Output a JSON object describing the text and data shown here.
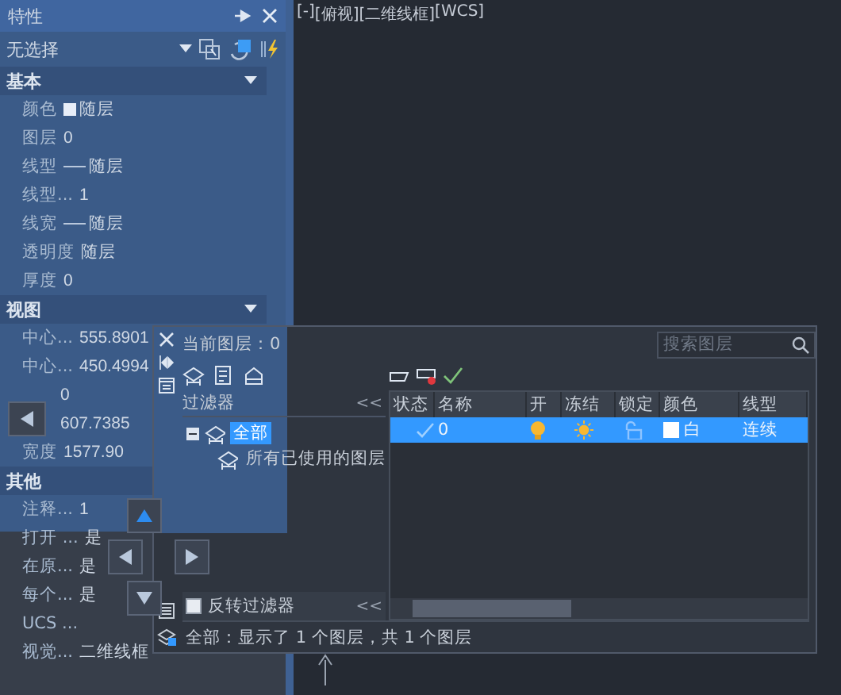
{
  "properties": {
    "title": "特性",
    "selection": "无选择",
    "sections": [
      {
        "title": "基本",
        "expanded": true,
        "rows": [
          {
            "kind": "color",
            "label": "颜色",
            "value": "随层"
          },
          {
            "kind": "text",
            "label": "图层",
            "value": "0"
          },
          {
            "kind": "linetype",
            "label": "线型",
            "value": "随层"
          },
          {
            "kind": "text",
            "label": "线型...",
            "value": "1"
          },
          {
            "kind": "linetype",
            "label": "线宽",
            "value": "随层"
          },
          {
            "kind": "text",
            "label": "透明度",
            "value": "随层"
          },
          {
            "kind": "text",
            "label": "厚度",
            "value": "0"
          }
        ]
      },
      {
        "title": "视图",
        "expanded": true,
        "rows": [
          {
            "kind": "text",
            "label": "中心...",
            "value": "555.8901"
          },
          {
            "kind": "text",
            "label": "中心...",
            "value": "450.4994"
          },
          {
            "kind": "text",
            "value": "0"
          },
          {
            "kind": "text",
            "value": "607.7385"
          },
          {
            "kind": "text",
            "label": "宽度",
            "value": "1577.90"
          }
        ]
      },
      {
        "title": "其他",
        "rows": [
          {
            "kind": "text",
            "label": "注释...",
            "value": "1"
          },
          {
            "kind": "text",
            "label": "打开 ...",
            "value": "是"
          },
          {
            "kind": "text",
            "label": "在原...",
            "value": "是"
          },
          {
            "kind": "text",
            "label": "每个...",
            "value": "是"
          },
          {
            "kind": "text",
            "label": "UCS ..."
          },
          {
            "kind": "text",
            "label": "视觉...",
            "value": "二维线框"
          }
        ]
      }
    ]
  },
  "viewport_controls": [
    "[-]",
    "[俯视]",
    "[二维线框]",
    "[WCS]"
  ],
  "layer_manager": {
    "current_layer": "当前图层：0",
    "search": {
      "placeholder": "搜索图层"
    },
    "filters_title": "过滤器",
    "filters_collapse": "<<",
    "filters": [
      {
        "label": "全部",
        "selected": true,
        "expanded": true,
        "children": [
          {
            "label": "所有已使用的图层",
            "selected": false
          }
        ]
      }
    ],
    "invert_filter": {
      "label": "反转过滤器",
      "checked": false
    },
    "invert_collapse": "<<",
    "columns": [
      "状态",
      "名称",
      "开",
      "冻结",
      "锁定",
      "颜色",
      "线型"
    ],
    "layers": [
      {
        "current": true,
        "name": "0",
        "on": true,
        "frozen": false,
        "locked": false,
        "color": "#ffffff",
        "color_name": "白",
        "linetype": "连续",
        "selected": true
      }
    ],
    "status": "全部：显示了 1 个图层，共 1 个图层"
  }
}
